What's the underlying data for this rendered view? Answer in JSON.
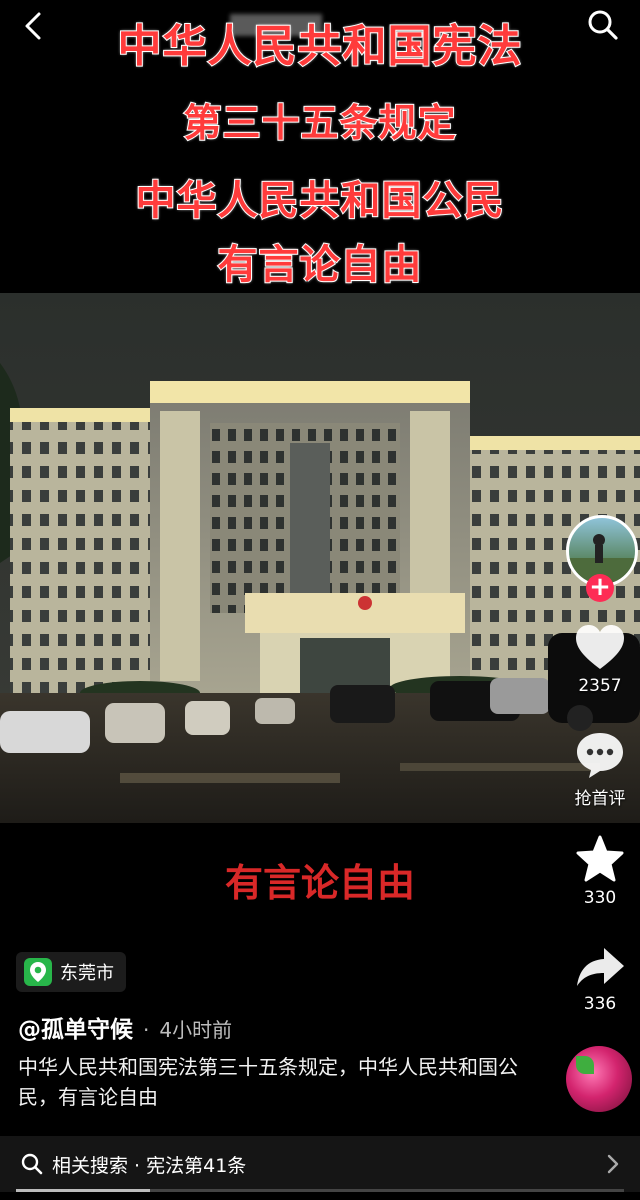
{
  "overlay": {
    "line1": "中华人民共和国宪法",
    "line2": "第三十五条规定",
    "line3": "中华人民共和国公民",
    "line4": "有言论自由"
  },
  "subtitle": "有言论自由",
  "actions": {
    "likes": "2357",
    "comment_label": "抢首评",
    "favorites": "330",
    "shares": "336"
  },
  "location": {
    "label": "东莞市",
    "icon": "location-pin-icon"
  },
  "author": {
    "name": "@孤单守候",
    "separator": "·",
    "time": "4小时前"
  },
  "caption": "中华人民共和国宪法第三十五条规定，中华人民共和国公民，有言论自由",
  "related": {
    "label": "相关搜索 · 宪法第41条"
  },
  "colors": {
    "accent": "#fe2c55",
    "overlay_text": "#ff3b3b",
    "location_green": "#28b64a"
  },
  "icons": [
    "back-icon",
    "search-icon",
    "heart-icon",
    "comment-icon",
    "star-icon",
    "share-icon",
    "chevron-right-icon"
  ]
}
